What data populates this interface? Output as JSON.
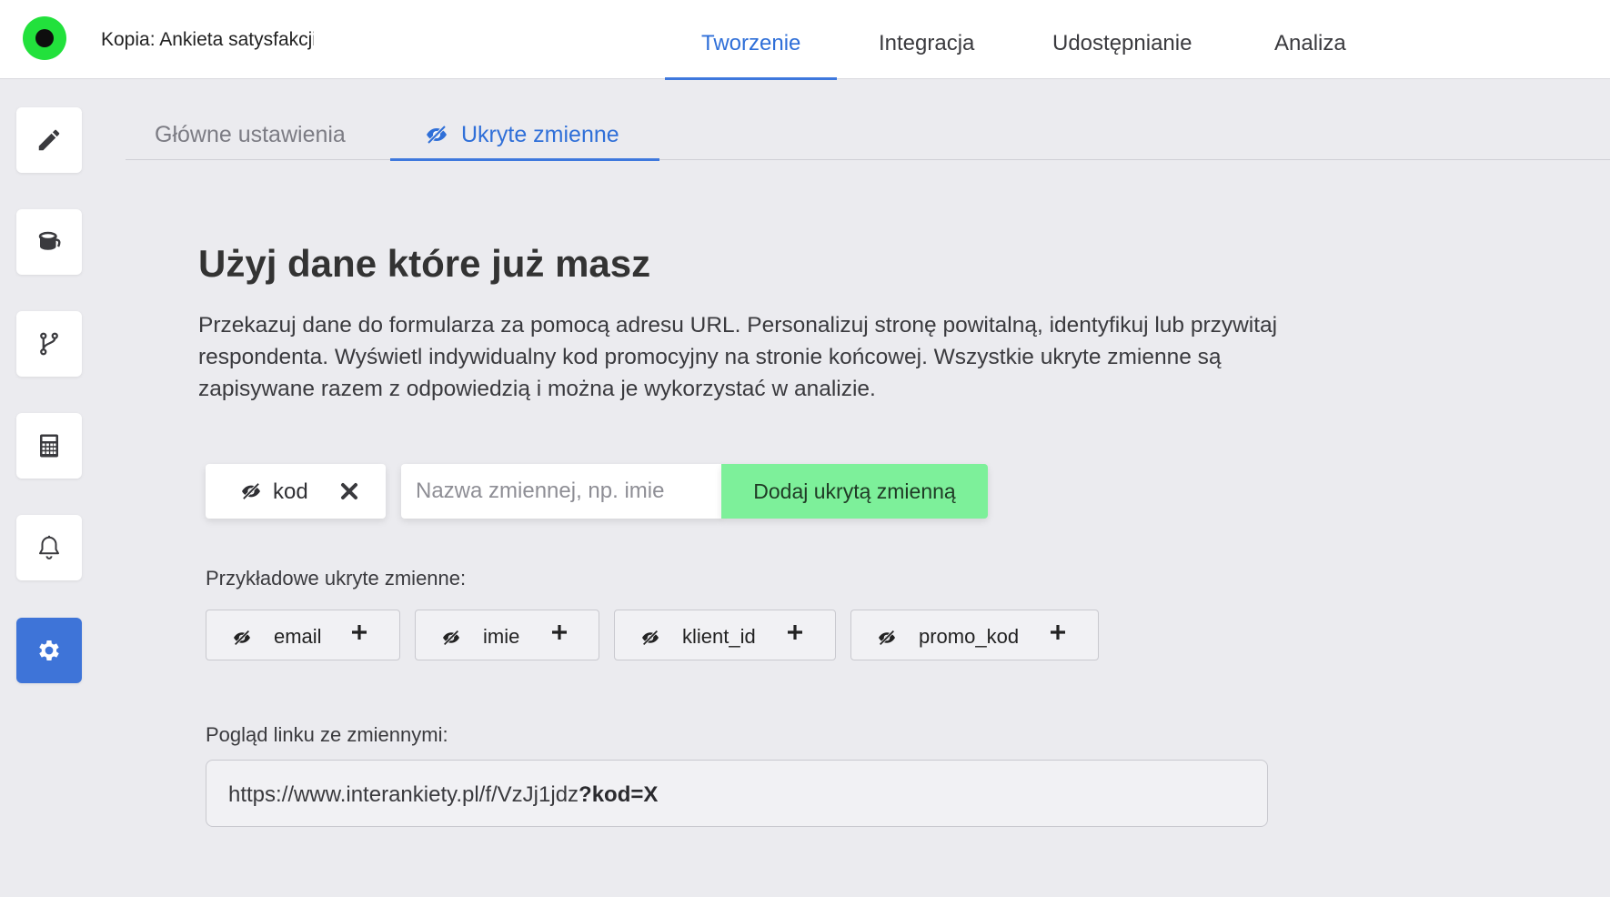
{
  "header": {
    "survey_title": "Kopia: Ankieta satysfakcji",
    "tabs": [
      {
        "label": "Tworzenie",
        "active": true
      },
      {
        "label": "Integracja",
        "active": false
      },
      {
        "label": "Udostępnianie",
        "active": false
      },
      {
        "label": "Analiza",
        "active": false
      }
    ]
  },
  "sidebar": {
    "items": [
      {
        "icon": "pencil-icon",
        "active": false
      },
      {
        "icon": "paint-bucket-icon",
        "active": false
      },
      {
        "icon": "branch-icon",
        "active": false
      },
      {
        "icon": "calculator-icon",
        "active": false
      },
      {
        "icon": "bell-icon",
        "active": false
      },
      {
        "icon": "gear-icon",
        "active": true
      }
    ]
  },
  "subtabs": [
    {
      "label": "Główne ustawienia",
      "active": false
    },
    {
      "label": "Ukryte zmienne",
      "active": true,
      "icon": "eye-slash-icon"
    }
  ],
  "content": {
    "heading": "Użyj dane które już masz",
    "description": "Przekazuj dane do formularza za pomocą adresu URL. Personalizuj stronę powitalną, identyfikuj lub przywitaj respondenta. Wyświetl indywidualny kod promocyjny na stronie końcowej. Wszystkie ukryte zmienne są zapisywane razem z odpowiedzią i można je wykorzystać w analizie.",
    "active_variable": "kod",
    "input_placeholder": "Nazwa zmiennej, np. imie",
    "add_button": "Dodaj ukrytą zmienną",
    "examples_label": "Przykładowe ukryte zmienne:",
    "examples": [
      "email",
      "imie",
      "klient_id",
      "promo_kod"
    ],
    "preview_label": "Pogląd linku ze zmiennymi:",
    "preview_url_base": "https://www.interankiety.pl/f/VzJj1jdz",
    "preview_url_query": "?kod=X"
  },
  "colors": {
    "accent": "#3e78dd",
    "add_button": "#7df09a",
    "logo_green": "#22e13c"
  }
}
